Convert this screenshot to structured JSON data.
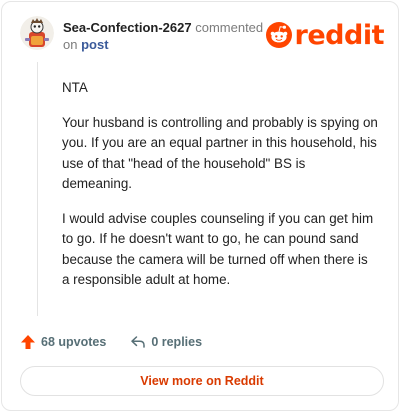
{
  "comment": {
    "username": "Sea-Confection-2627",
    "action_text": "commented",
    "preposition": "on",
    "target_link": "post",
    "paragraphs": [
      "NTA",
      "Your husband is controlling and probably is spying on you. If you are an equal partner in this household, his use of that \"head of the household\" BS is demeaning.",
      "I would advise couples counseling if you can get him to go. If he doesn't want to go, he can pound sand because the camera will be turned off when there is a responsible adult at home."
    ],
    "upvotes": "68 upvotes",
    "replies": "0 replies"
  },
  "brand": {
    "wordmark": "reddit",
    "color": "#ff4500"
  },
  "footer": {
    "view_more_label": "View more on Reddit"
  },
  "icons": {
    "avatar": "user-avatar",
    "upvote": "upvote-arrow-icon",
    "reply": "reply-arrow-icon",
    "logo": "reddit-snoo-icon"
  }
}
